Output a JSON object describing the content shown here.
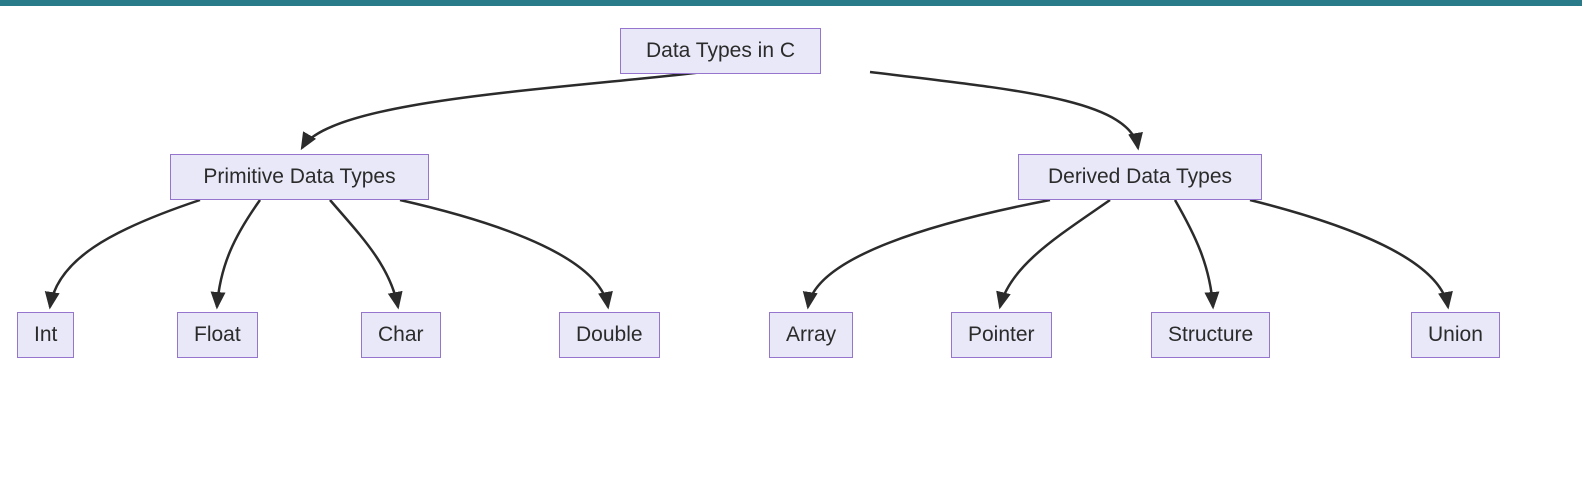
{
  "diagram": {
    "root": {
      "label": "Data Types in C"
    },
    "level1": {
      "primitive": "Primitive Data Types",
      "derived": "Derived Data Types"
    },
    "leaves": {
      "int": "Int",
      "float": "Float",
      "char": "Char",
      "double": "Double",
      "array": "Array",
      "pointer": "Pointer",
      "structure": "Structure",
      "union": "Union"
    }
  },
  "colors": {
    "node_fill": "#e8e8f8",
    "node_border": "#9575cd",
    "arrow": "#2b2b2b",
    "topbar": "#2a7b8a"
  }
}
